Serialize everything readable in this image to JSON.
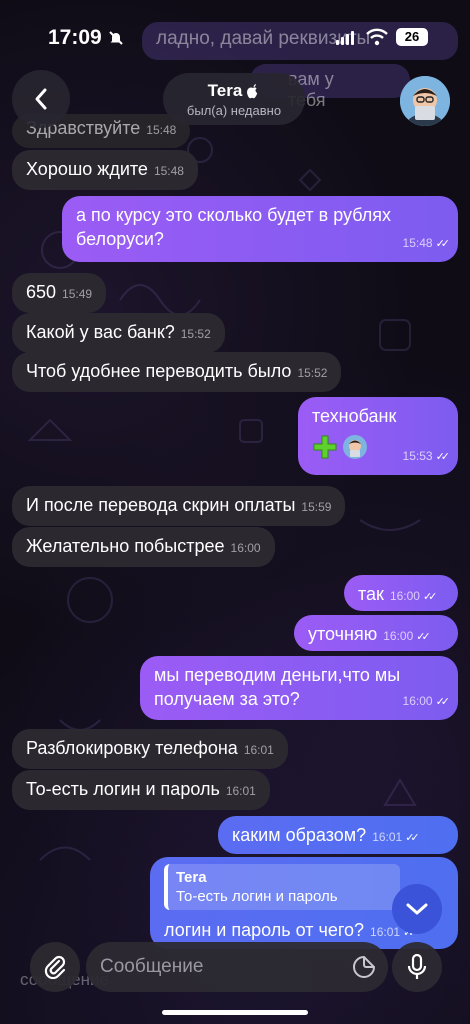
{
  "status_bar": {
    "time": "17:09",
    "battery": "26"
  },
  "ghost_messages": {
    "top1": "ладно, давай реквизиты",
    "top2": "вам у тебя",
    "bottom1": "сообщение"
  },
  "header": {
    "name": "Tera",
    "status": "был(а) недавно"
  },
  "messages": [
    {
      "text": "Здравствуйте",
      "time": "15:48"
    },
    {
      "text": "Хорошо ждите",
      "time": "15:48"
    },
    {
      "text": "а по курсу это сколько будет в рублях белоруси?",
      "time": "15:48"
    },
    {
      "text": "650",
      "time": "15:49"
    },
    {
      "text": "Какой у вас банк?",
      "time": "15:52"
    },
    {
      "text": "Чтоб удобнее переводить было",
      "time": "15:52"
    },
    {
      "text": "технобанк",
      "time": "15:53"
    },
    {
      "text": "И после перевода скрин оплаты",
      "time": "15:59"
    },
    {
      "text": "Желательно побыстрее",
      "time": "16:00"
    },
    {
      "text": "так",
      "time": "16:00"
    },
    {
      "text": "уточняю",
      "time": "16:00"
    },
    {
      "text": "мы переводим деньги,что мы получаем за это?",
      "time": "16:00"
    },
    {
      "text": "Разблокировку телефона",
      "time": "16:01"
    },
    {
      "text": "То-есть логин и пароль",
      "time": "16:01"
    },
    {
      "text": "каким образом?",
      "time": "16:01"
    },
    {
      "text": "логин и пароль от чего?",
      "time": "16:01",
      "reply_name": "Tera",
      "reply_text": "То-есть логин и пароль"
    }
  ],
  "input": {
    "placeholder": "Сообщение"
  },
  "colors": {
    "outgoing": "#8b5cf6",
    "incoming": "#2b2830",
    "accent_blue": "#3a53d8"
  }
}
